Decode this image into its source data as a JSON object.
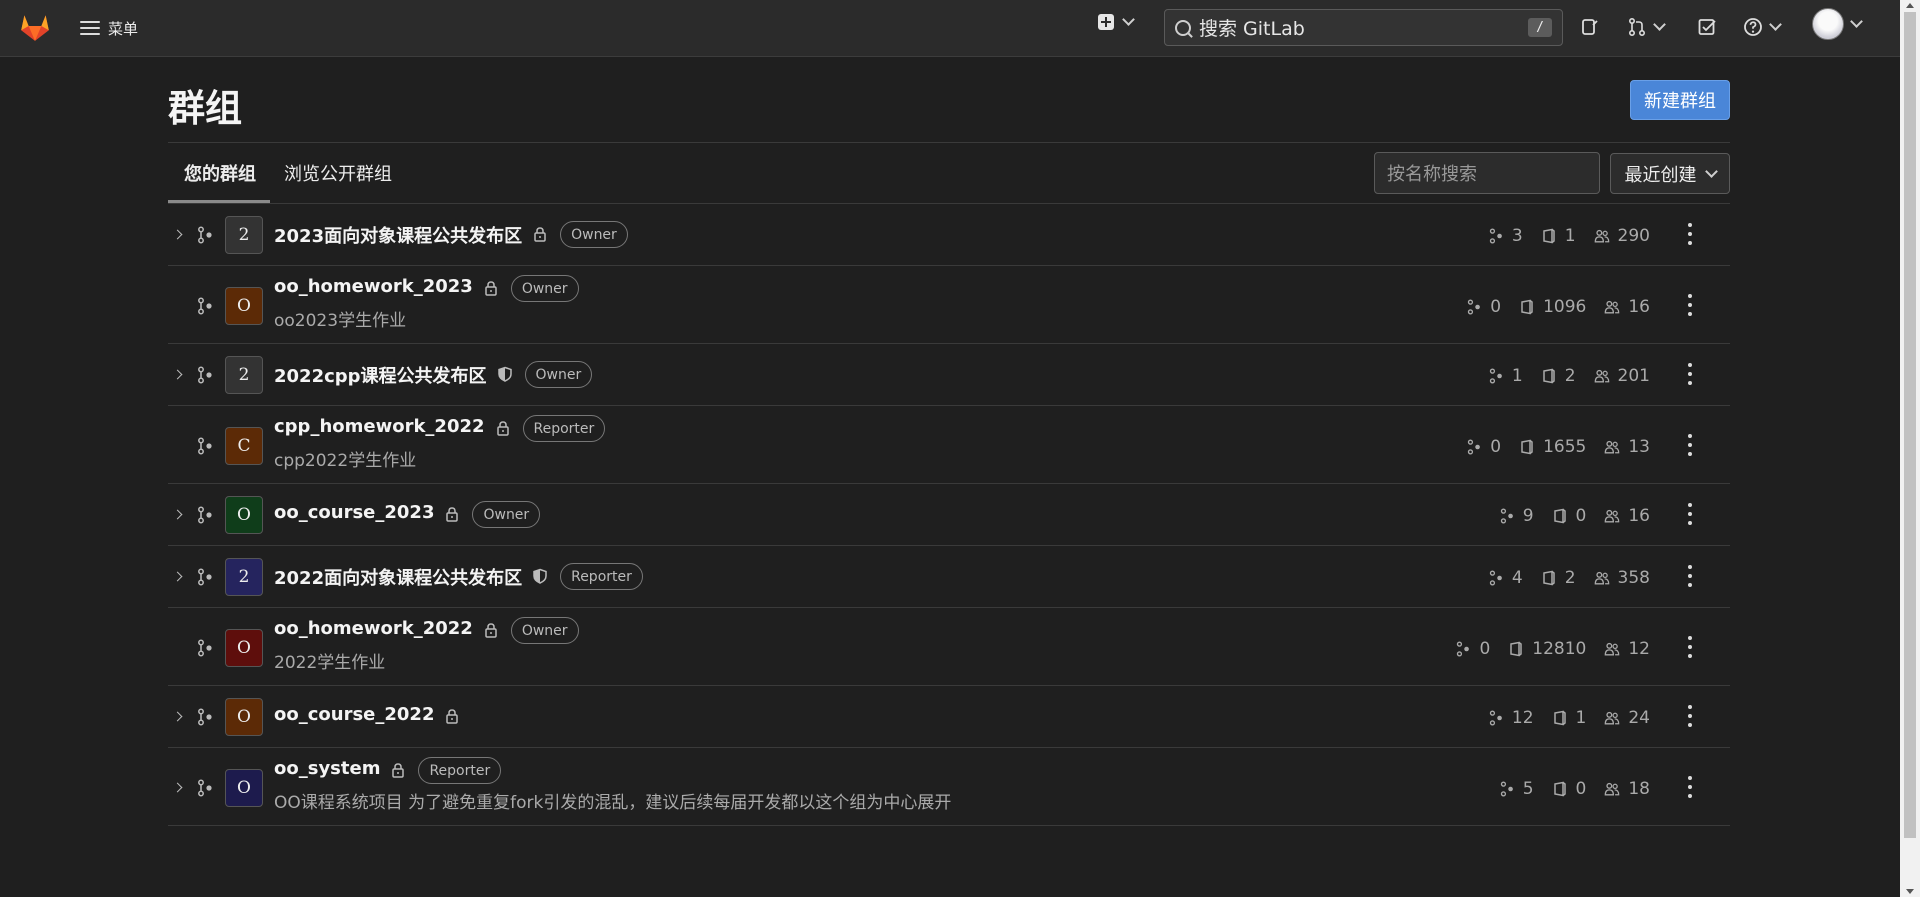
{
  "nav": {
    "menu_label": "菜单",
    "search_placeholder": "搜索 GitLab",
    "search_shortcut": "/"
  },
  "page": {
    "title": "群组",
    "new_group_button": "新建群组"
  },
  "tabs": [
    {
      "label": "您的群组",
      "active": true
    },
    {
      "label": "浏览公开群组",
      "active": false
    }
  ],
  "filter": {
    "placeholder": "按名称搜索",
    "sort_label": "最近创建"
  },
  "colors": {
    "accent": "#4a86d8",
    "background": "#1f1f1f",
    "navbar": "#2b2b2b"
  },
  "groups": [
    {
      "avatar": "2",
      "avatar_color": "#333333",
      "name": "2023面向对象课程公共发布区",
      "visibility": "lock-icon",
      "role": "Owner",
      "description": "",
      "expandable": true,
      "subgroups": "3",
      "projects": "1",
      "members": "290"
    },
    {
      "avatar": "O",
      "avatar_color": "#5c2a06",
      "name": "oo_homework_2023",
      "visibility": "lock-icon",
      "role": "Owner",
      "description": "oo2023学生作业",
      "expandable": false,
      "subgroups": "0",
      "projects": "1096",
      "members": "16"
    },
    {
      "avatar": "2",
      "avatar_color": "#333333",
      "name": "2022cpp课程公共发布区",
      "visibility": "shield-icon",
      "role": "Owner",
      "description": "",
      "expandable": true,
      "subgroups": "1",
      "projects": "2",
      "members": "201"
    },
    {
      "avatar": "C",
      "avatar_color": "#5c2a06",
      "name": "cpp_homework_2022",
      "visibility": "lock-icon",
      "role": "Reporter",
      "description": "cpp2022学生作业",
      "expandable": false,
      "subgroups": "0",
      "projects": "1655",
      "members": "13"
    },
    {
      "avatar": "O",
      "avatar_color": "#0f3d1a",
      "name": "oo_course_2023",
      "visibility": "lock-icon",
      "role": "Owner",
      "description": "",
      "expandable": true,
      "subgroups": "9",
      "projects": "0",
      "members": "16"
    },
    {
      "avatar": "2",
      "avatar_color": "#25245e",
      "name": "2022面向对象课程公共发布区",
      "visibility": "shield-icon",
      "role": "Reporter",
      "description": "",
      "expandable": true,
      "subgroups": "4",
      "projects": "2",
      "members": "358"
    },
    {
      "avatar": "O",
      "avatar_color": "#5e0e0c",
      "name": "oo_homework_2022",
      "visibility": "lock-icon",
      "role": "Owner",
      "description": "2022学生作业",
      "expandable": false,
      "subgroups": "0",
      "projects": "12810",
      "members": "12"
    },
    {
      "avatar": "O",
      "avatar_color": "#5c2a06",
      "name": "oo_course_2022",
      "visibility": "lock-icon",
      "role": "",
      "description": "",
      "expandable": true,
      "subgroups": "12",
      "projects": "1",
      "members": "24"
    },
    {
      "avatar": "O",
      "avatar_color": "#1d1b4d",
      "name": "oo_system",
      "visibility": "lock-icon",
      "role": "Reporter",
      "description": "OO课程系统项目 为了避免重复fork引发的混乱，建议后续每届开发都以这个组为中心展开",
      "expandable": true,
      "subgroups": "5",
      "projects": "0",
      "members": "18"
    }
  ]
}
